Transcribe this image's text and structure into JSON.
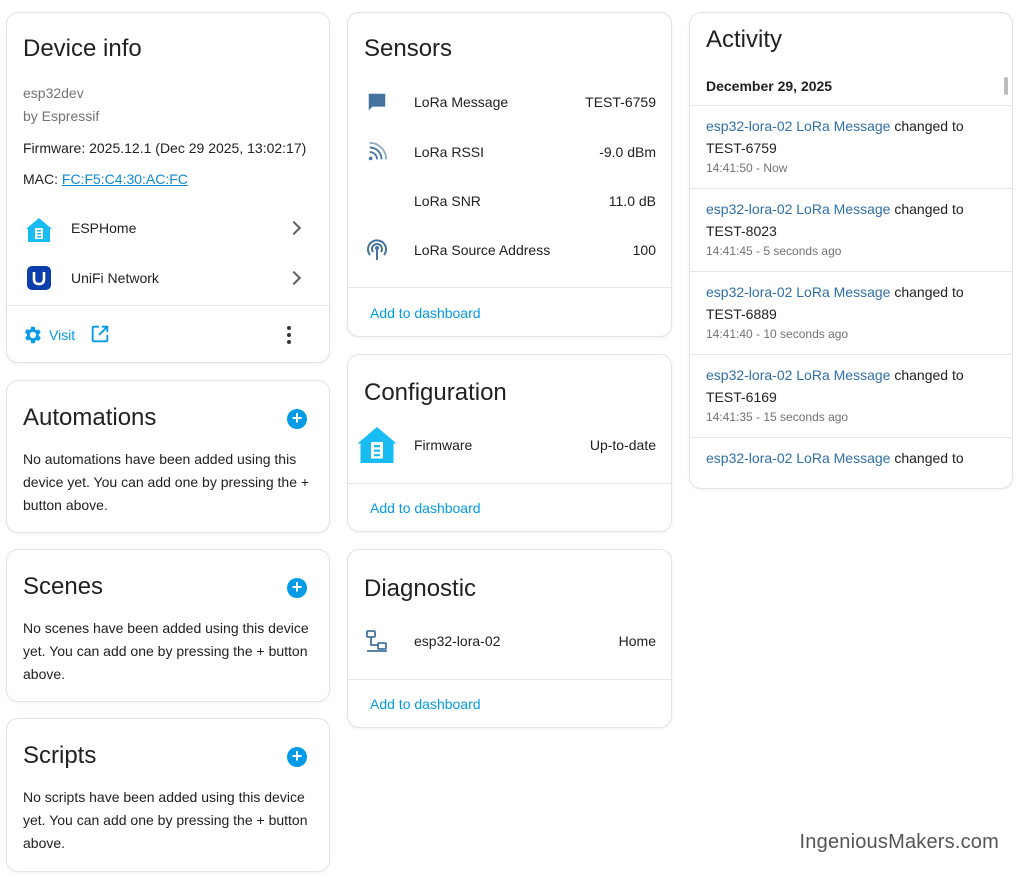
{
  "device_info": {
    "title": "Device info",
    "model": "esp32dev",
    "manufacturer": "by Espressif",
    "firmware": "Firmware: 2025.12.1 (Dec 29 2025, 13:02:17)",
    "mac_label": "MAC: ",
    "mac_value": "FC:F5:C4:30:AC:FC",
    "integrations": [
      {
        "label": "ESPHome",
        "icon": "esphome-icon"
      },
      {
        "label": "UniFi Network",
        "icon": "unifi-icon"
      }
    ],
    "visit_label": "Visit"
  },
  "automations": {
    "title": "Automations",
    "empty_text": "No automations have been added using this device yet. You can add one by pressing the + button above."
  },
  "scenes": {
    "title": "Scenes",
    "empty_text": "No scenes have been added using this device yet. You can add one by pressing the + button above."
  },
  "scripts": {
    "title": "Scripts",
    "empty_text": "No scripts have been added using this device yet. You can add one by pressing the + button above."
  },
  "sensors": {
    "title": "Sensors",
    "rows": [
      {
        "label": "LoRa Message",
        "value": "TEST-6759",
        "icon": "message-icon"
      },
      {
        "label": "LoRa RSSI",
        "value": "-9.0 dBm",
        "icon": "signal-icon"
      },
      {
        "label": "LoRa SNR",
        "value": "11.0 dB",
        "icon": ""
      },
      {
        "label": "LoRa Source Address",
        "value": "100",
        "icon": "broadcast-icon"
      }
    ],
    "add_label": "Add to dashboard"
  },
  "configuration": {
    "title": "Configuration",
    "rows": [
      {
        "label": "Firmware",
        "value": "Up-to-date",
        "icon": "esphome-icon"
      }
    ],
    "add_label": "Add to dashboard"
  },
  "diagnostic": {
    "title": "Diagnostic",
    "rows": [
      {
        "label": "esp32-lora-02",
        "value": "Home",
        "icon": "network-icon"
      }
    ],
    "add_label": "Add to dashboard"
  },
  "activity": {
    "title": "Activity",
    "date": "December 29, 2025",
    "entries": [
      {
        "entity": "esp32-lora-02 LoRa Message",
        "action": " changed to",
        "value": "TEST-6759",
        "time": "14:41:50 - Now"
      },
      {
        "entity": "esp32-lora-02 LoRa Message",
        "action": " changed to",
        "value": "TEST-8023",
        "time": "14:41:45 - 5 seconds ago"
      },
      {
        "entity": "esp32-lora-02 LoRa Message",
        "action": " changed to",
        "value": "TEST-6889",
        "time": "14:41:40 - 10 seconds ago"
      },
      {
        "entity": "esp32-lora-02 LoRa Message",
        "action": " changed to",
        "value": "TEST-6169",
        "time": "14:41:35 - 15 seconds ago"
      },
      {
        "entity": "esp32-lora-02 LoRa Message",
        "action": " changed to",
        "value": "",
        "time": ""
      }
    ]
  },
  "watermark": "IngeniousMakers.com",
  "colors": {
    "accent": "#039be5",
    "link": "#0b8bd0",
    "entity_link": "#2f6fa8",
    "esphome": "#18bcf2",
    "unifi": "#0b3dab"
  }
}
